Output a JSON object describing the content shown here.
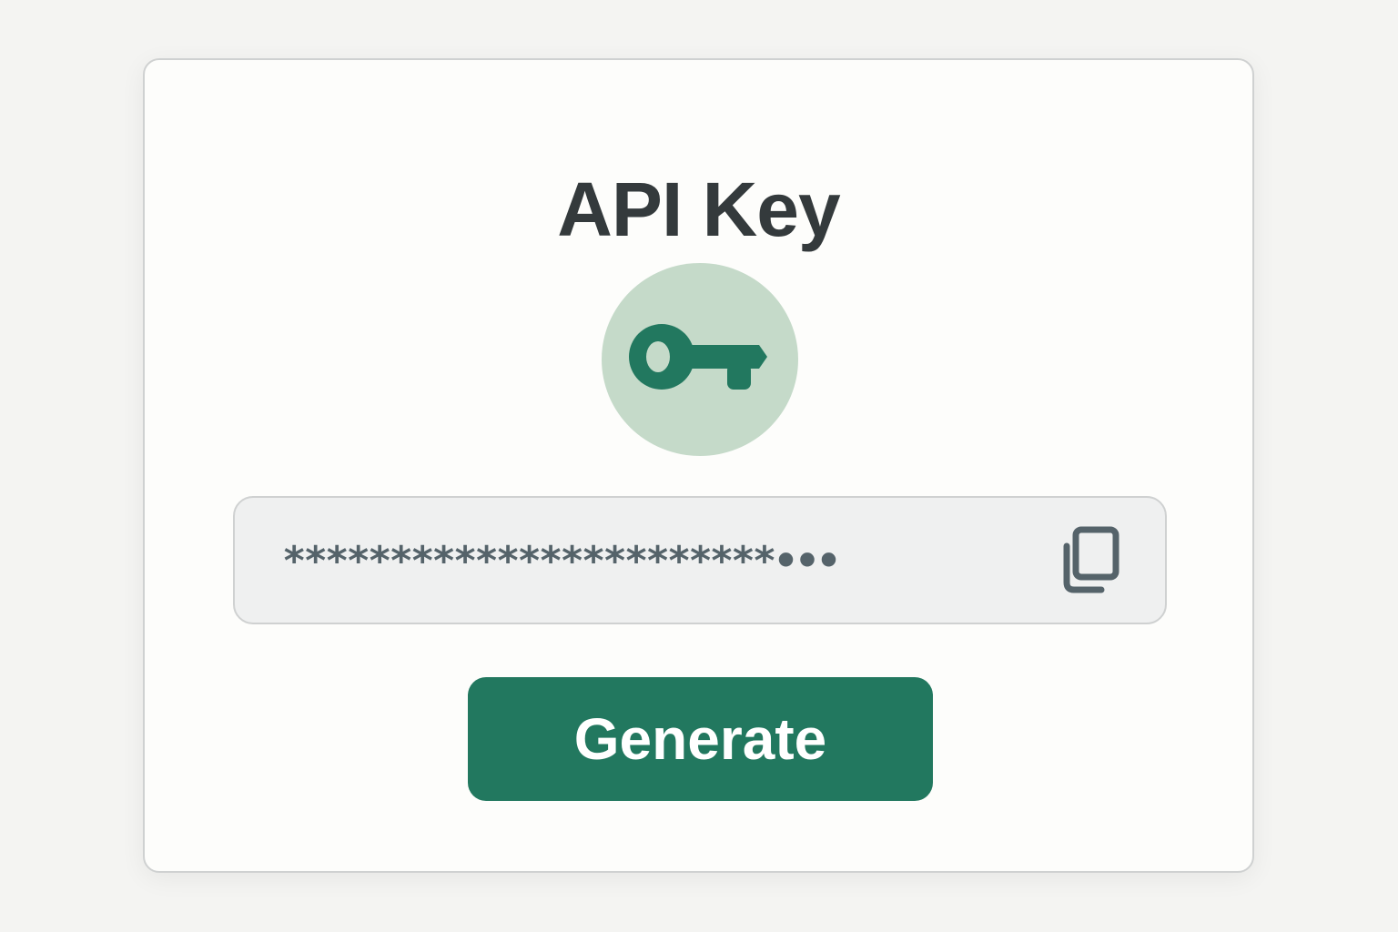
{
  "card": {
    "title": "API Key",
    "key_icon": "key-icon",
    "key_field": {
      "value": "***********************•••",
      "copy_icon": "copy-icon"
    },
    "generate_label": "Generate"
  },
  "colors": {
    "background": "#f4f4f2",
    "card": "#fdfdfb",
    "title_text": "#343a3c",
    "accent": "#22785f",
    "badge_bg": "#c5dac9",
    "field_bg": "#eff0f0",
    "masked_text": "#55636a"
  }
}
